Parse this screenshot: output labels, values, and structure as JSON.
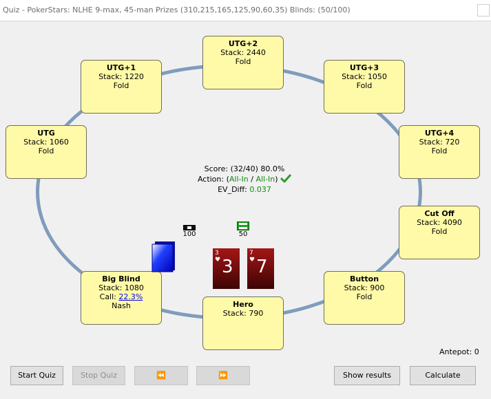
{
  "window": {
    "title": "Quiz - PokerStars: NLHE 9-max, 45-man Prizes (310,215,165,125,90,60,35) Blinds: (50/100)"
  },
  "seats": {
    "utg2": {
      "name": "UTG+2",
      "stack": "Stack: 2440",
      "action": "Fold"
    },
    "utg1": {
      "name": "UTG+1",
      "stack": "Stack: 1220",
      "action": "Fold"
    },
    "utg3": {
      "name": "UTG+3",
      "stack": "Stack: 1050",
      "action": "Fold"
    },
    "utg": {
      "name": "UTG",
      "stack": "Stack: 1060",
      "action": "Fold"
    },
    "utg4": {
      "name": "UTG+4",
      "stack": "Stack: 720",
      "action": "Fold"
    },
    "cutoff": {
      "name": "Cut Off",
      "stack": "Stack: 4090",
      "action": "Fold"
    },
    "button": {
      "name": "Button",
      "stack": "Stack: 900",
      "action": "Fold"
    },
    "bigblind": {
      "name": "Big Blind",
      "stack": "Stack: 1080",
      "call_label": "Call:",
      "call_pct": "22.3%",
      "action": "Nash"
    },
    "hero": {
      "name": "Hero",
      "stack": "Stack: 790"
    }
  },
  "info": {
    "score": "Score: (32/40) 80.0%",
    "action_label": "Action:",
    "action_open": "(",
    "action_a": "All-In",
    "action_sep": "/",
    "action_b": "All-In",
    "action_close": ")",
    "ev_label": "EV_Diff:",
    "ev_value": "0.037"
  },
  "chips": {
    "bb_amount": "100",
    "sb_amount": "50"
  },
  "hero_cards": [
    {
      "rank": "3",
      "suit": "♥",
      "big": "3"
    },
    {
      "rank": "7",
      "suit": "♥",
      "big": "7"
    }
  ],
  "antepot": "Antepot: 0",
  "buttons": {
    "start_quiz": "Start Quiz",
    "stop_quiz": "Stop Quiz",
    "prev": "⏪",
    "next": "⏩",
    "show_results": "Show results",
    "calculate": "Calculate"
  },
  "colors": {
    "seat_bg": "#fffaa8",
    "table_rail": "#7f9cbd",
    "dealer_button": "#0000ff",
    "card": "#8b0c0c",
    "positive": "#0a8f0a"
  }
}
